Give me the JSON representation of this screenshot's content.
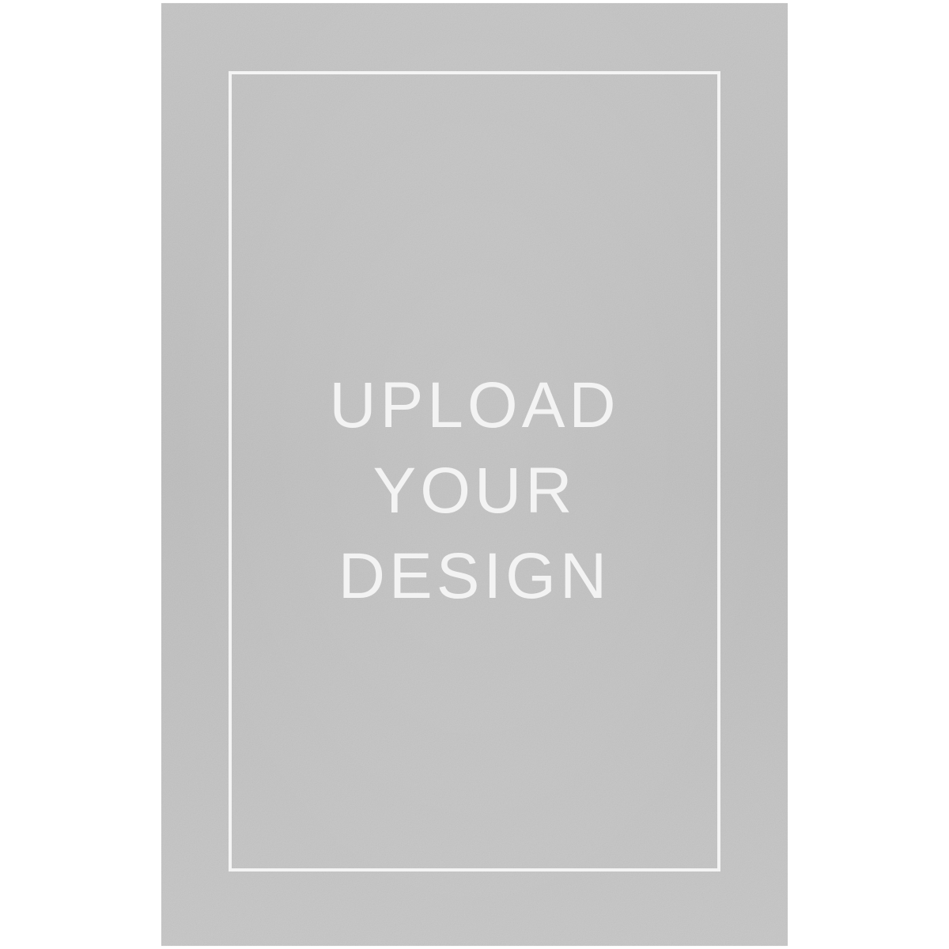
{
  "card": {
    "lines": [
      "UPLOAD",
      "YOUR",
      "DESIGN"
    ]
  },
  "colors": {
    "page_background": "#ffffff",
    "card_fill": "#c2c2c2",
    "border_and_text": "#f3f3f3"
  }
}
